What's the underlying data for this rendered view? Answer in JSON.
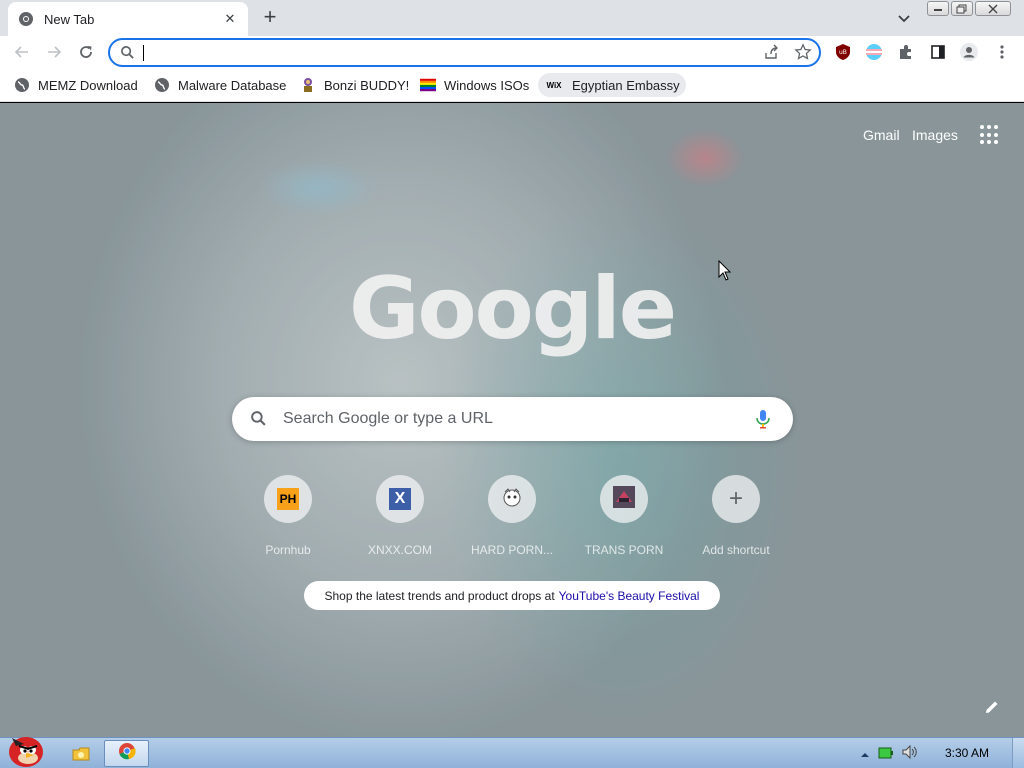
{
  "browser": {
    "tab": {
      "title": "New Tab",
      "close_glyph": "✕"
    },
    "newtab_glyph": "+",
    "omnibox": {
      "value": "",
      "placeholder": ""
    },
    "bookmarks": [
      {
        "label": "MEMZ Download",
        "icon": "globe-icon"
      },
      {
        "label": "Malware Database",
        "icon": "globe-icon"
      },
      {
        "label": "Bonzi BUDDY!",
        "icon": "bonzi-icon"
      },
      {
        "label": "Windows ISOs",
        "icon": "rainbow-flag-icon"
      },
      {
        "label": "Egyptian Embassy",
        "icon": "wix-icon",
        "icon_text": "WiX"
      }
    ],
    "extensions": [
      "ublock-origin-icon",
      "trans-flag-icon",
      "extensions-puzzle-icon",
      "side-panel-icon",
      "profile-icon",
      "menu-kebab-icon"
    ]
  },
  "ntp": {
    "header_links": {
      "gmail": "Gmail",
      "images": "Images"
    },
    "logo_text": "Google",
    "search_placeholder": "Search Google or type a URL",
    "shortcuts": [
      {
        "label": "Pornhub",
        "icon_text": "PH"
      },
      {
        "label": "XNXX.COM",
        "icon_text": "X"
      },
      {
        "label": "HARD PORN...",
        "icon_text": ""
      },
      {
        "label": "TRANS PORN",
        "icon_text": ""
      },
      {
        "label": "Add shortcut",
        "icon_text": "+"
      }
    ],
    "promo": {
      "text": "Shop the latest trends and product drops at",
      "link": "YouTube's Beauty Festival"
    }
  },
  "taskbar": {
    "clock": "3:30 AM"
  },
  "colors": {
    "accent": "#1a73e8",
    "tabstrip": "#dee1e6",
    "taskbar": "#a7c3e4"
  }
}
